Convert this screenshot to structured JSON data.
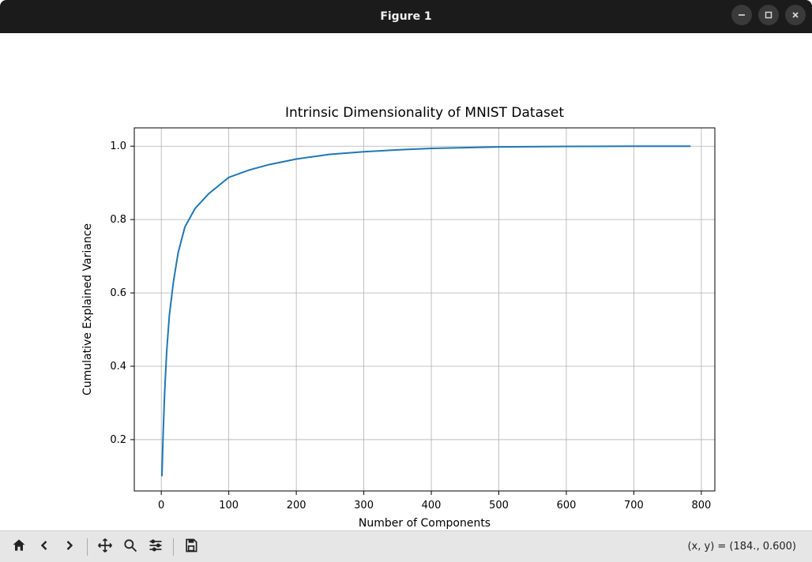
{
  "window": {
    "title": "Figure 1"
  },
  "toolbar": {
    "home_tip": "Home",
    "back_tip": "Back",
    "forward_tip": "Forward",
    "pan_tip": "Pan",
    "zoom_tip": "Zoom",
    "subplots_tip": "Configure subplots",
    "save_tip": "Save",
    "coord_readout": "(x, y) = (184., 0.600)"
  },
  "chart_data": {
    "type": "line",
    "title": "Intrinsic Dimensionality of MNIST Dataset",
    "xlabel": "Number of Components",
    "ylabel": "Cumulative Explained Variance",
    "xlim": [
      -40,
      820
    ],
    "ylim": [
      0.06,
      1.05
    ],
    "xticks": [
      0,
      100,
      200,
      300,
      400,
      500,
      600,
      700,
      800
    ],
    "yticks": [
      0.2,
      0.4,
      0.6,
      0.8,
      1.0
    ],
    "series": [
      {
        "name": "cumulative_explained_variance",
        "color": "#1f77b4",
        "x": [
          1,
          2,
          3,
          5,
          8,
          12,
          18,
          25,
          35,
          50,
          70,
          100,
          130,
          160,
          200,
          250,
          300,
          350,
          400,
          500,
          600,
          700,
          784
        ],
        "y": [
          0.1,
          0.17,
          0.23,
          0.33,
          0.44,
          0.54,
          0.63,
          0.71,
          0.78,
          0.83,
          0.87,
          0.915,
          0.935,
          0.95,
          0.965,
          0.978,
          0.985,
          0.99,
          0.994,
          0.998,
          0.9995,
          1.0,
          1.0
        ]
      }
    ]
  }
}
